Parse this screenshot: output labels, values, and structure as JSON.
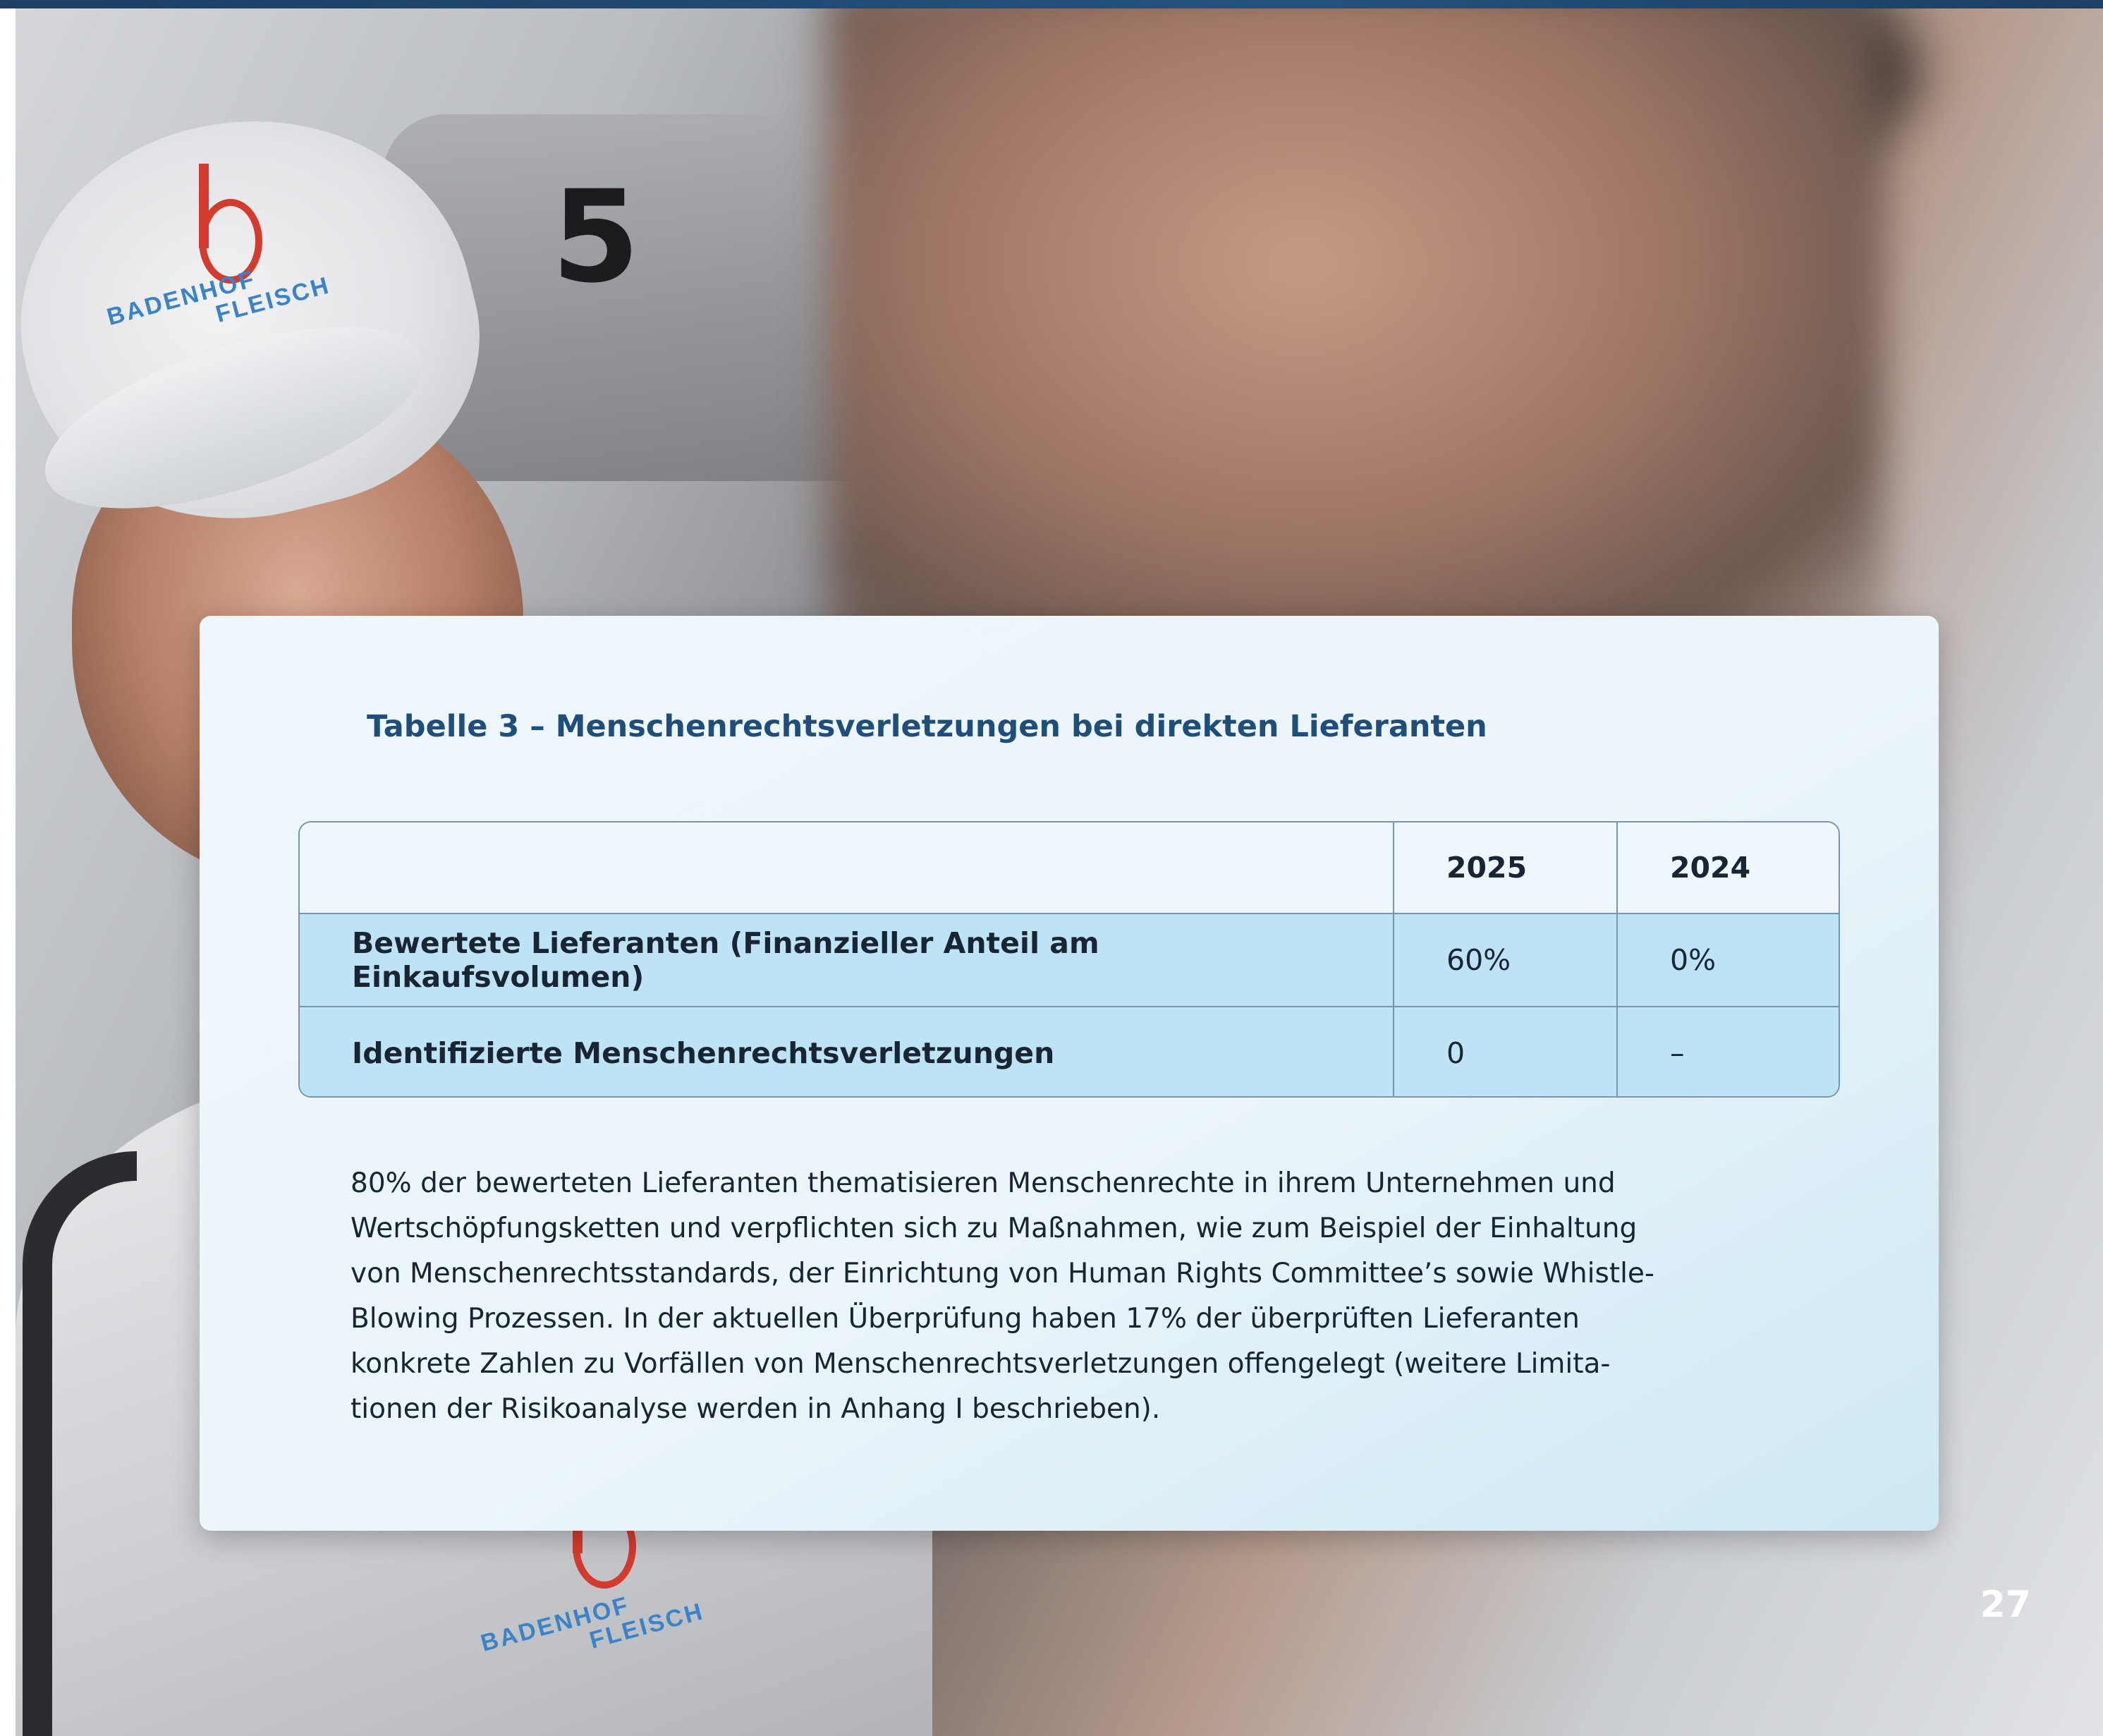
{
  "photo": {
    "machine_number": "5",
    "logo_lines": [
      "BADENHOF",
      "FLEISCH"
    ]
  },
  "card": {
    "title": "Tabelle 3 – Menschenrechtsverletzungen bei direkten Lieferanten",
    "table": {
      "headers": [
        "",
        "2025",
        "2024"
      ],
      "rows": [
        {
          "label": "Bewertete Lieferanten (Finanzieller Anteil am Einkaufsvolumen)",
          "y2025": "60%",
          "y2024": "0%"
        },
        {
          "label": "Identifizierte Menschenrechtsverletzungen",
          "y2025": "0",
          "y2024": "–"
        }
      ]
    },
    "paragraph_lines": [
      "80% der bewerteten Lieferanten thematisieren Menschenrechte in ihrem Unternehmen und",
      "Wertschöpfungsketten und verpflichten sich zu Maßnahmen, wie zum Beispiel der Einhaltung",
      "von Menschenrechtsstandards, der Einrichtung von Human Rights Committee’s sowie Whistle-",
      "Blowing Prozessen. In der aktuellen Überprüfung haben 17% der überprüften Lieferanten",
      "konkrete Zahlen zu Vorfällen von Menschenrechtsverletzungen offengelegt (weitere Limita-",
      "tionen der Risikoanalyse werden in Anhang I beschrieben)."
    ]
  },
  "page_number": "27",
  "colors": {
    "brand_blue": "#1f4e7a",
    "table_row_fill": "#bde3f4",
    "logo_red": "#d33b2f",
    "logo_blue": "#3a83c9"
  }
}
